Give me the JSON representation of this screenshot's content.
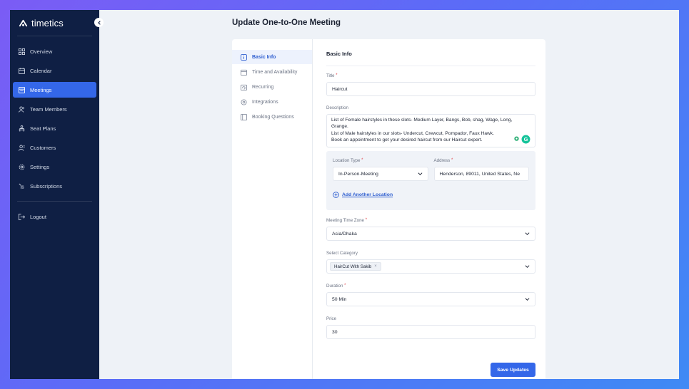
{
  "app": {
    "name": "timetics"
  },
  "sidebar": {
    "items": [
      {
        "label": "Overview",
        "icon": "grid-icon"
      },
      {
        "label": "Calendar",
        "icon": "calendar-icon"
      },
      {
        "label": "Meetings",
        "icon": "meetings-icon",
        "active": true
      },
      {
        "label": "Team Members",
        "icon": "users-icon"
      },
      {
        "label": "Seat Plans",
        "icon": "seat-icon"
      },
      {
        "label": "Customers",
        "icon": "customers-icon"
      },
      {
        "label": "Settings",
        "icon": "gear-icon"
      },
      {
        "label": "Subscriptions",
        "icon": "subscription-icon"
      }
    ],
    "logout_label": "Logout"
  },
  "page": {
    "title": "Update One-to-One Meeting"
  },
  "steps": [
    {
      "label": "Basic Info",
      "active": true
    },
    {
      "label": "Time and Availability"
    },
    {
      "label": "Recurring"
    },
    {
      "label": "Integrations"
    },
    {
      "label": "Booking Questions"
    }
  ],
  "form": {
    "section_title": "Basic Info",
    "title_label": "Title",
    "title_value": "Haircut",
    "description_label": "Description",
    "description_lines": [
      "List of Female hairstyles in these slots- Medium Layer, Bangs, Bob, shag, Wage, Long,",
      "Grange.",
      "List of Male hairstyles in our slots- Undercut, Crewcut, Pompador, Faux Hawk.",
      "Book an appointment to get your desired haircut from our Haircut expert."
    ],
    "location_type_label": "Location Type",
    "location_type_value": "In-Person-Meeting",
    "address_label": "Address",
    "address_value": "Henderson, 89011, United States, Ne",
    "add_location_label": "Add Another Location",
    "timezone_label": "Meeting Time Zone",
    "timezone_value": "Asia/Dhaka",
    "category_label": "Select Category",
    "category_chip": "HairCut With Sakib",
    "duration_label": "Duration",
    "duration_value": "50 Min",
    "price_label": "Price",
    "price_value": "30",
    "save_label": "Save Updates",
    "required_mark": "*"
  },
  "colors": {
    "sidebar_bg": "#0f1f44",
    "accent": "#3467e9",
    "required": "#e0434a"
  }
}
